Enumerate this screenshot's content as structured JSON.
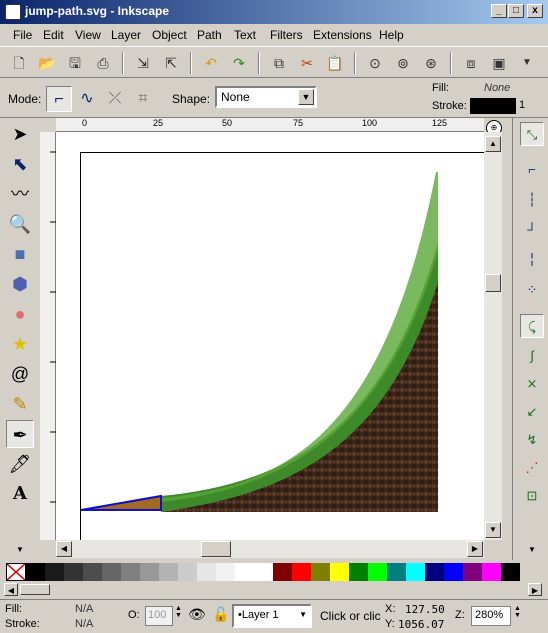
{
  "window": {
    "title": "jump-path.svg - Inkscape",
    "min": "_",
    "max": "□",
    "close": "x"
  },
  "menu": [
    "File",
    "Edit",
    "View",
    "Layer",
    "Object",
    "Path",
    "Text",
    "Filters",
    "Extensions",
    "Help"
  ],
  "toolbar2": {
    "mode_label": "Mode:",
    "shape_label": "Shape:",
    "shape_value": "None",
    "fill_label": "Fill:",
    "fill_value": "None",
    "stroke_label": "Stroke:",
    "stroke_width": "1"
  },
  "ruler": {
    "top_ticks": [
      "0",
      "25",
      "50",
      "75",
      "100",
      "125"
    ],
    "zoom_badge": "⊕"
  },
  "palette": {
    "colors": [
      "#000000",
      "#1a1a1a",
      "#333333",
      "#4d4d4d",
      "#666666",
      "#808080",
      "#999999",
      "#b3b3b3",
      "#cccccc",
      "#e6e6e6",
      "#f2f2f2",
      "#ffffff",
      "#ffffff",
      "#800000",
      "#ff0000",
      "#808000",
      "#ffff00",
      "#008000",
      "#00ff00",
      "#008080",
      "#00ffff",
      "#000080",
      "#0000ff",
      "#800080",
      "#ff00ff",
      "#000000"
    ]
  },
  "status": {
    "fill_label": "Fill:",
    "fill_value": "N/A",
    "stroke_label": "Stroke:",
    "stroke_value": "N/A",
    "opacity_label": "O:",
    "opacity_value": "100",
    "layer": "•Layer 1",
    "message": "Click or clic",
    "x_label": "X:",
    "x_value": "127.50",
    "y_label": "Y:",
    "y_value": "1056.07",
    "zoom_label": "Z:",
    "zoom_value": "280%"
  },
  "colors": {
    "accent": "#0a246a",
    "grass": "#3e8a2a",
    "soil": "#3b2418",
    "highlight_fill": "#a06a20",
    "highlight_stroke": "#1010cc"
  }
}
